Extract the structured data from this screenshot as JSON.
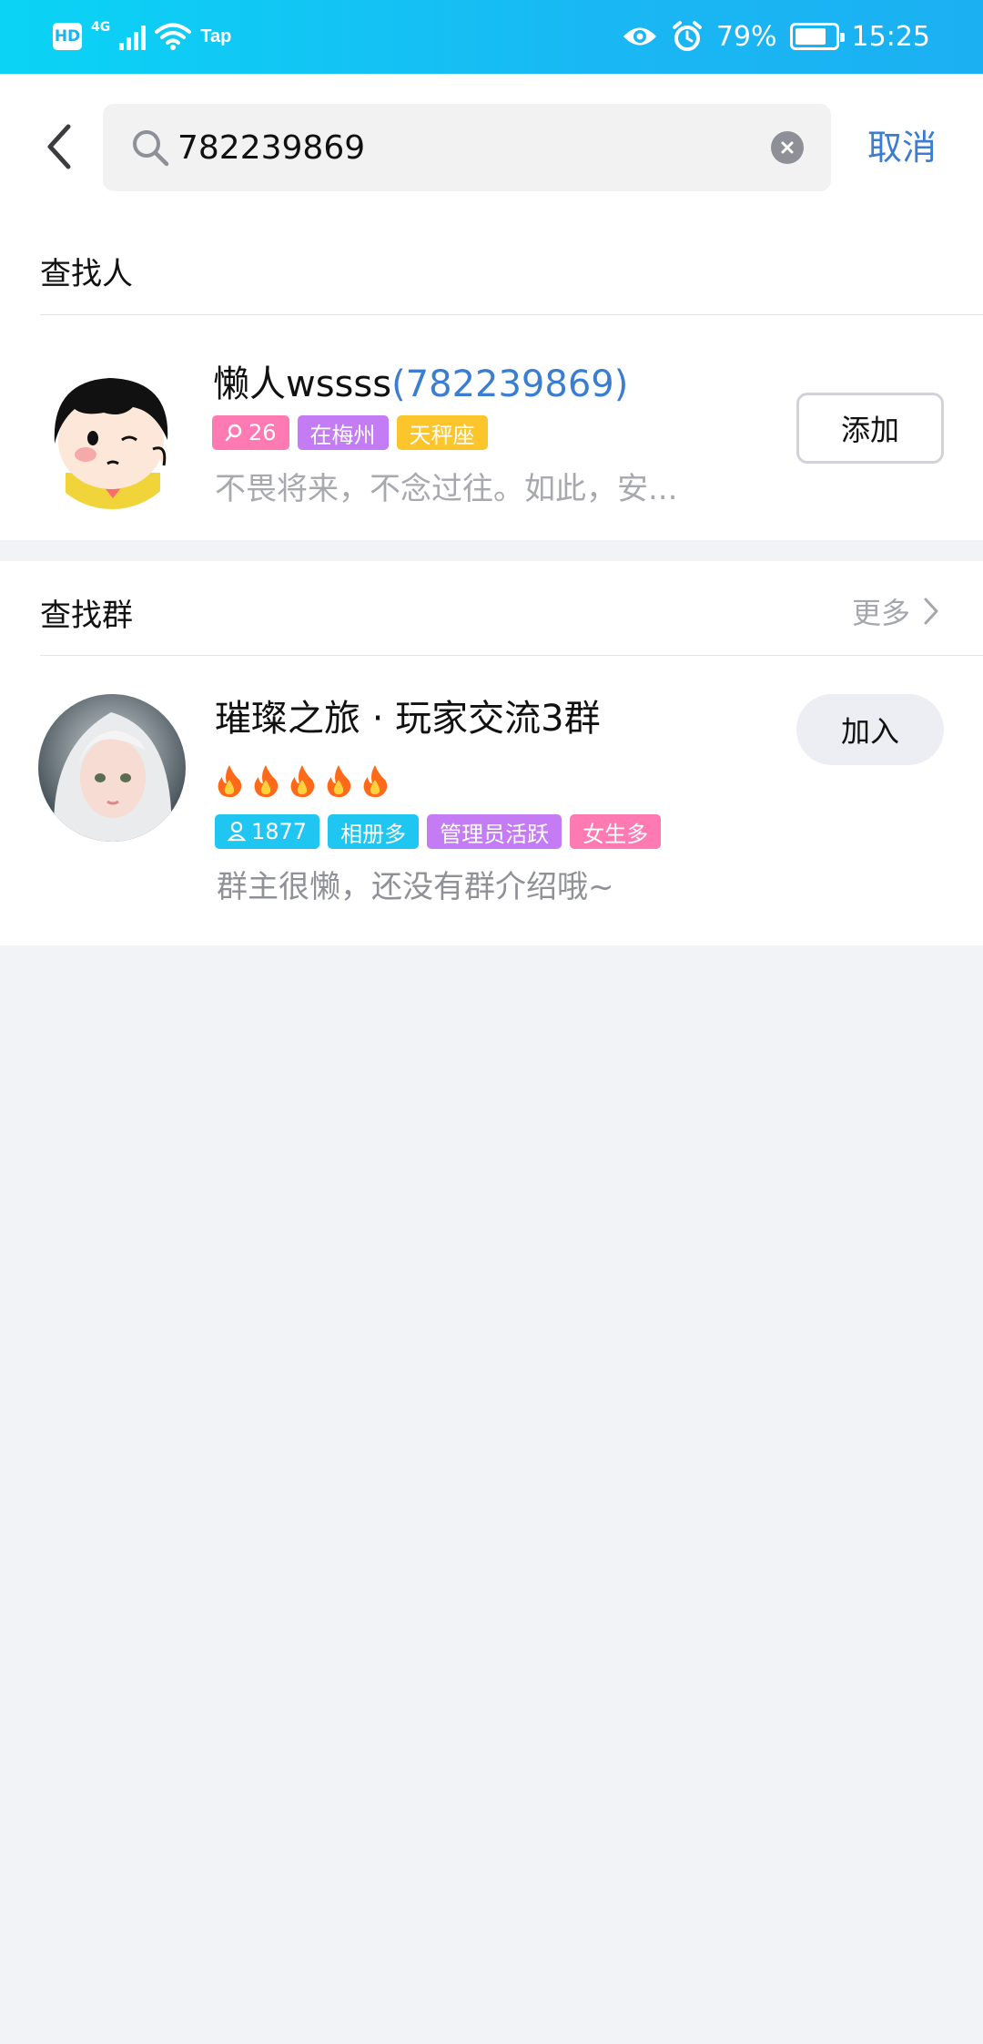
{
  "status_bar": {
    "hd": "HD",
    "network": "4G",
    "tap": "Tap",
    "battery_text": "79%",
    "battery_level": 0.79,
    "time": "15:25"
  },
  "search": {
    "query": "782239869",
    "cancel_label": "取消"
  },
  "people_section": {
    "title": "查找人",
    "result": {
      "name": "懒人wssss",
      "qq_number": "(782239869)",
      "tags": [
        {
          "icon": "search-icon",
          "text": "26",
          "color": "#ff79b3"
        },
        {
          "text": "在梅州",
          "color": "#c47cf5"
        },
        {
          "text": "天秤座",
          "color": "#fbc52b"
        }
      ],
      "signature": "不畏将来，不念过往。如此，安...",
      "add_label": "添加"
    }
  },
  "group_section": {
    "title": "查找群",
    "more_label": "更多",
    "result": {
      "name": "璀璨之旅 · 玩家交流3群",
      "fire_count": 5,
      "tags": [
        {
          "icon": "person-icon",
          "text": "1877",
          "color": "#20c6f2"
        },
        {
          "text": "相册多",
          "color": "#20c6f2"
        },
        {
          "text": "管理员活跃",
          "color": "#c47cf5"
        },
        {
          "text": "女生多",
          "color": "#ff79b3"
        }
      ],
      "description": "群主很懒，还没有群介绍哦~",
      "join_label": "加入"
    }
  },
  "colors": {
    "accent_blue": "#3a7dd1",
    "status_bar": "#19b8f4",
    "page_bg": "#f2f3f7"
  }
}
